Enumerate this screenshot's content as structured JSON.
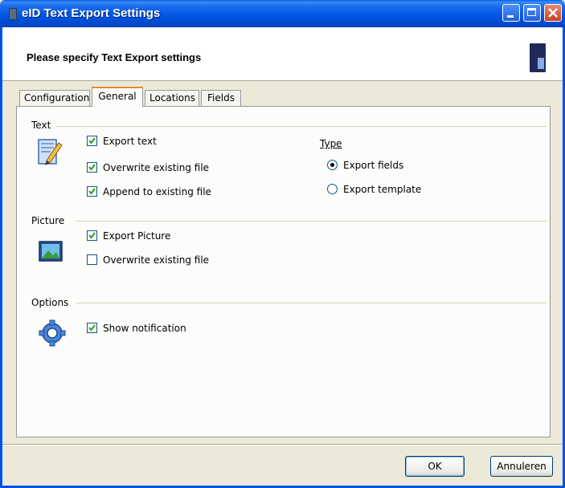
{
  "window": {
    "title": "eID Text Export Settings"
  },
  "header": {
    "text": "Please specify Text Export settings"
  },
  "tabs": [
    {
      "label": "Configuration"
    },
    {
      "label": "General"
    },
    {
      "label": "Locations"
    },
    {
      "label": "Fields"
    }
  ],
  "active_tab": "General",
  "groups": {
    "text": {
      "label": "Text",
      "checks": [
        {
          "label": "Export text",
          "checked": true
        },
        {
          "label": "Overwrite existing file",
          "checked": true
        },
        {
          "label": "Append to existing file",
          "checked": true
        }
      ],
      "type": {
        "label": "Type",
        "options": [
          {
            "label": "Export fields",
            "selected": true
          },
          {
            "label": "Export template",
            "selected": false
          }
        ]
      }
    },
    "picture": {
      "label": "Picture",
      "checks": [
        {
          "label": "Export Picture",
          "checked": true
        },
        {
          "label": "Overwrite existing file",
          "checked": false
        }
      ]
    },
    "options": {
      "label": "Options",
      "checks": [
        {
          "label": "Show notification",
          "checked": true
        }
      ]
    }
  },
  "buttons": {
    "ok": "OK",
    "cancel": "Annuleren"
  },
  "icons": {
    "title": "app-icon",
    "text_group": "edit-document-icon",
    "picture_group": "picture-icon",
    "options_group": "gear-icon"
  }
}
